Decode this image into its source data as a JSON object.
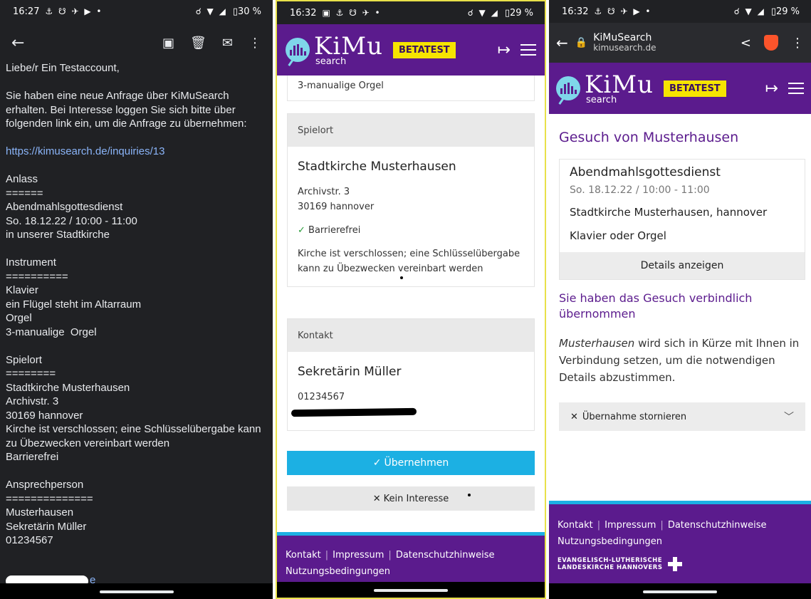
{
  "phone1": {
    "status": {
      "time": "16:27",
      "left_icons": "⚓ ☋ ✈ ▶ •",
      "right_icons": "☌ ▼ ◢",
      "battery": "▯30 %"
    },
    "icons": {
      "back": "back-arrow-icon",
      "archive": "archive-icon",
      "delete": "trash-icon",
      "mail": "mail-icon",
      "more": "more-vert-icon"
    },
    "body": [
      "Liebe/r Ein Testaccount,",
      "",
      "Sie haben eine neue Anfrage über KiMuSearch erhalten. Bei Interesse loggen Sie sich bitte über folgenden link ein, um die Anfrage zu übernehmen:",
      "",
      "https://kimusearch.de/inquiries/13",
      "",
      "Anlass",
      "======",
      "Abendmahlsgottesdienst",
      "So. 18.12.22 / 10:00 - 11:00",
      "in unserer Stadtkirche",
      "",
      "Instrument",
      "==========",
      "Klavier",
      "ein Flügel steht im Altarraum",
      "Orgel",
      "3-manualige  Orgel",
      "",
      "Spielort",
      "========",
      "Stadtkirche Musterhausen",
      "Archivstr. 3",
      "30169 hannover",
      "Kirche ist verschlossen; eine Schlüsselübergabe kann zu Übezwecken vereinbart werden",
      "Barrierefrei",
      "",
      "Ansprechperson",
      "==============",
      "Musterhausen",
      "Sekretärin Müller",
      "01234567"
    ],
    "link": "https://kimusearch.de/inquiries/13",
    "tail_fragment": "e"
  },
  "phone2": {
    "status": {
      "time": "16:32",
      "left_icons": "▣ ⚓ ☋ ✈ •",
      "right_icons": "☌ ▼ ◢",
      "battery": "▯29 %"
    },
    "brand": {
      "name": "KiMu",
      "sub": "search",
      "badge": "BETATEST"
    },
    "prev_line": "3-manualige Orgel",
    "venue": {
      "header": "Spielort",
      "name": "Stadtkirche Musterhausen",
      "street": "Archivstr. 3",
      "city": "30169 hannover",
      "accessible": "Barrierefrei",
      "note": "Kirche ist verschlossen; eine Schlüsselübergabe kann zu Übezwecken vereinbart werden"
    },
    "contact": {
      "header": "Kontakt",
      "name": "Sekretärin Müller",
      "phone": "01234567"
    },
    "buttons": {
      "accept": "Übernehmen",
      "reject": "Kein Interesse"
    },
    "footer": {
      "kontakt": "Kontakt",
      "impressum": "Impressum",
      "datenschutz": "Datenschutzhinweise",
      "nutzung": "Nutzungsbedingungen"
    }
  },
  "phone3": {
    "status": {
      "time": "16:32",
      "left_icons": "⚓ ☋ ✈ ▶ •",
      "right_icons": "☌ ▼ ◢",
      "battery": "▯29 %"
    },
    "browser": {
      "title": "KiMuSearch",
      "url": "kimusearch.de"
    },
    "brand": {
      "name": "KiMu",
      "sub": "search",
      "badge": "BETATEST"
    },
    "page_title": "Gesuch von Musterhausen",
    "request": {
      "event": "Abendmahlsgottesdienst",
      "datetime": "So. 18.12.22 / 10:00 - 11:00",
      "location": "Stadtkirche Musterhausen, hannover",
      "instrument": "Klavier oder Orgel",
      "details_button": "Details anzeigen"
    },
    "confirmed_heading": "Sie haben das Gesuch verbindlich übernommen",
    "info_name": "Musterhausen",
    "info_rest": " wird sich in Kürze mit Ihnen in Verbindung setzen, um die notwendigen Details abzustimmen.",
    "cancel_label": "Übernahme stornieren",
    "footer": {
      "kontakt": "Kontakt",
      "impressum": "Impressum",
      "datenschutz": "Datenschutzhinweise",
      "nutzung": "Nutzungsbedingungen",
      "church_line1": "EVANGELISCH-LUTHERISCHE",
      "church_line2": "LANDESKIRCHE HANNOVERS"
    }
  },
  "colors": {
    "brand_purple": "#5b1b8d",
    "accent_blue": "#1cb0e3",
    "beta_yellow": "#f6e400",
    "success_green": "#2a9d3a"
  }
}
